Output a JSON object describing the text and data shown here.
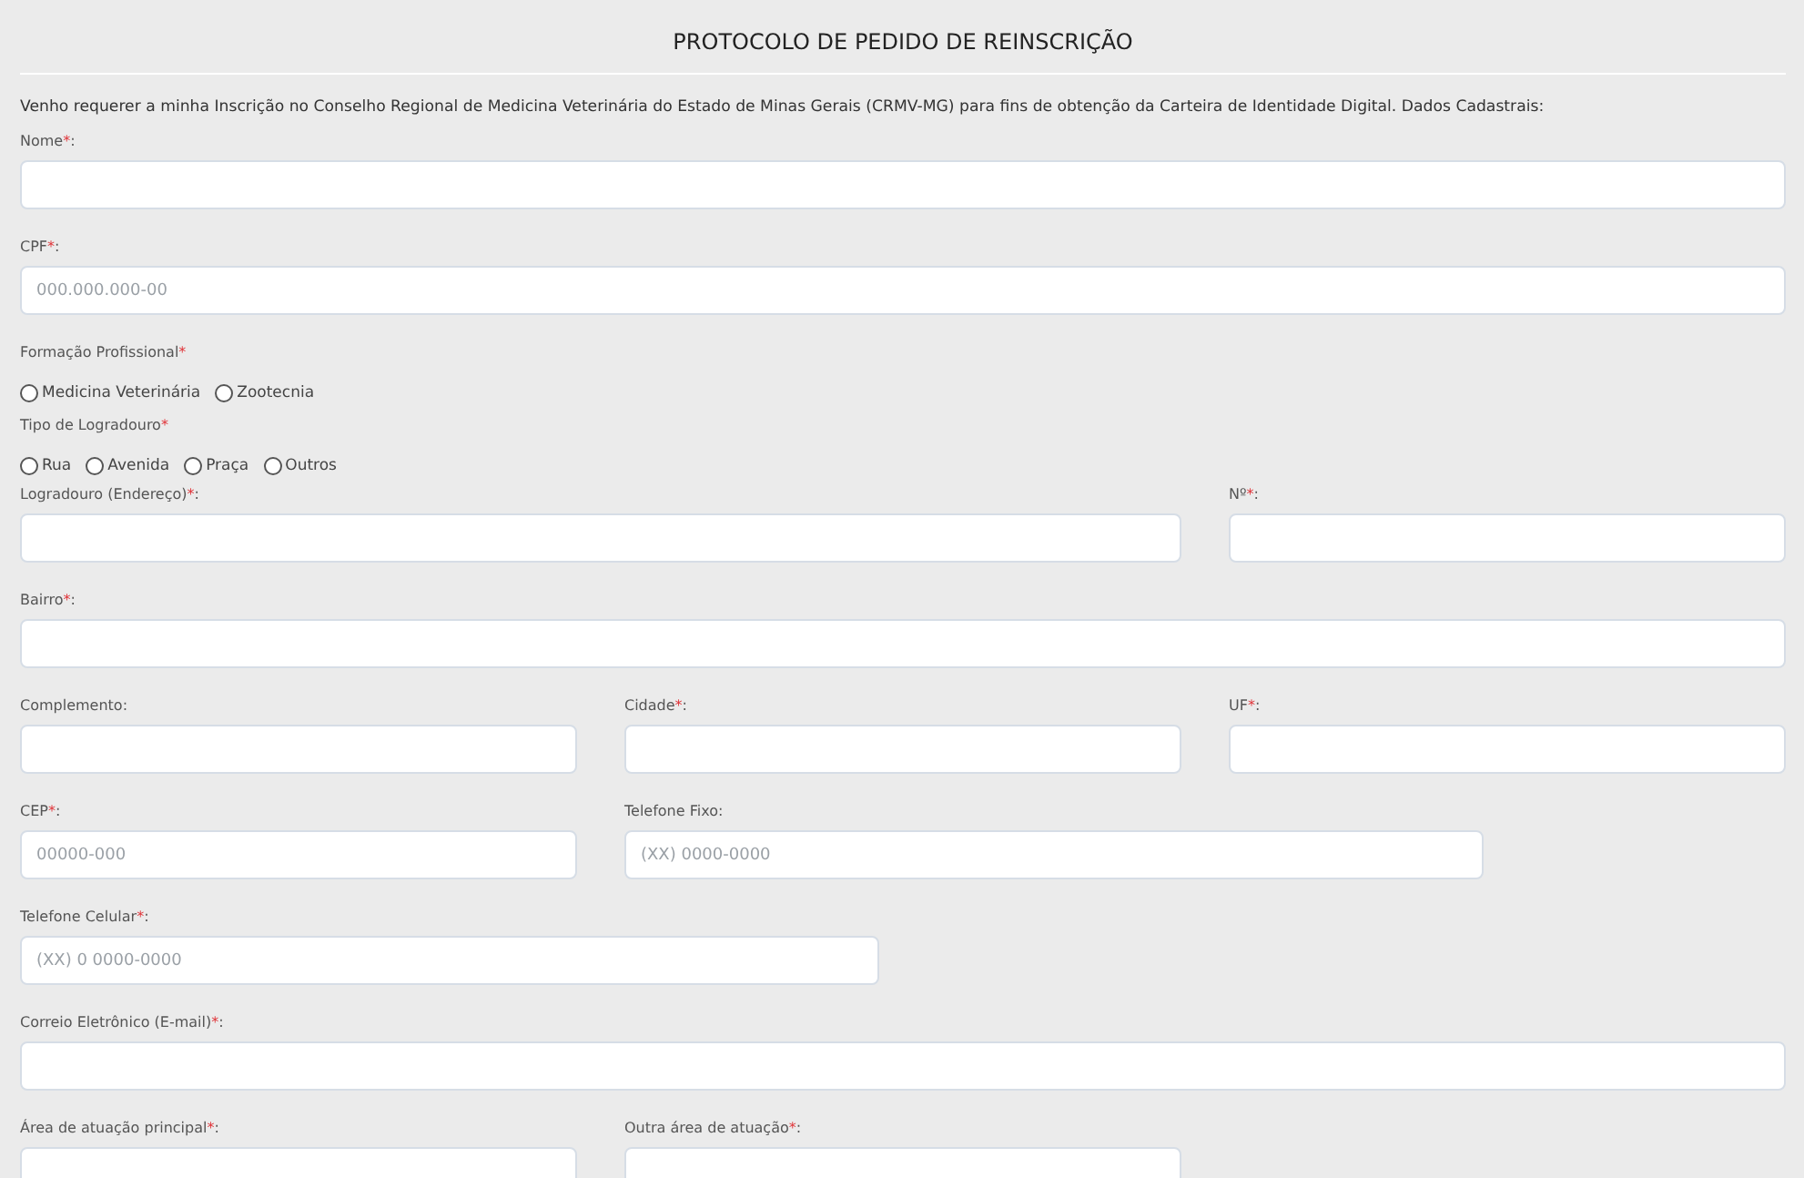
{
  "title": "PROTOCOLO DE PEDIDO DE REINSCRIÇÃO",
  "intro": "Venho requerer a minha Inscrição no Conselho Regional de Medicina Veterinária do Estado de Minas Gerais (CRMV-MG) para fins de obtenção da Carteira de Identidade Digital. Dados Cadastrais:",
  "rows": [
    {
      "fields": [
        {
          "kind": "input",
          "label": "Nome",
          "mark": "*",
          "colon": ":"
        }
      ]
    },
    {
      "fields": [
        {
          "kind": "input",
          "label": "CPF",
          "mark": "*",
          "colon": ":",
          "placeholder": "000.000.000-00"
        }
      ]
    },
    {
      "fields": [
        {
          "kind": "radio_group",
          "label": "Formação Profissional",
          "mark": "*",
          "options": [
            {
              "label": "Medicina Veterinária",
              "selected": false
            },
            {
              "label": "Zootecnia",
              "selected": false
            }
          ]
        }
      ]
    },
    {
      "fields": [
        {
          "kind": "radio_group",
          "label": "Tipo de Logradouro",
          "mark": "*",
          "options": [
            {
              "label": "Rua",
              "selected": false
            },
            {
              "label": "Avenida",
              "selected": false
            },
            {
              "label": "Praça",
              "selected": false
            },
            {
              "label": "Outros",
              "selected": false
            }
          ]
        }
      ]
    },
    {
      "fields": [
        {
          "kind": "input",
          "label": "Logradouro (Endereço)",
          "mark": "*",
          "colon": ":"
        },
        {
          "kind": "input",
          "label": "Nº",
          "mark": "*",
          "colon": ":"
        }
      ]
    },
    {
      "fields": [
        {
          "kind": "input",
          "label": "Bairro",
          "mark": "*",
          "colon": ":"
        }
      ]
    },
    {
      "fields": [
        {
          "kind": "input",
          "label": "Complemento",
          "colon": ":"
        },
        {
          "kind": "input",
          "label": "Cidade",
          "mark": "*",
          "colon": ":"
        },
        {
          "kind": "input",
          "label": "UF",
          "mark": "*",
          "colon": ":"
        }
      ]
    },
    {
      "fields": [
        {
          "kind": "input",
          "label": "CEP",
          "mark": "*",
          "colon": ":",
          "placeholder": "00000-000"
        },
        {
          "kind": "input",
          "label": "Telefone Fixo",
          "colon": ":",
          "placeholder": "(XX) 0000-0000"
        }
      ]
    },
    {
      "fields": [
        {
          "kind": "input",
          "label": "Telefone Celular",
          "mark": "*",
          "colon": ":",
          "placeholder": "(XX) 0 0000-0000"
        }
      ]
    },
    {
      "fields": [
        {
          "kind": "input",
          "label": "Correio Eletrônico (E-mail)",
          "mark": "*",
          "colon": ":"
        }
      ]
    },
    {
      "fields": [
        {
          "kind": "input",
          "label": "Área de atuação principal",
          "mark": "*",
          "colon": ":"
        },
        {
          "kind": "input",
          "label": "Outra área de atuação",
          "mark": "*",
          "colon": ":"
        }
      ]
    }
  ]
}
